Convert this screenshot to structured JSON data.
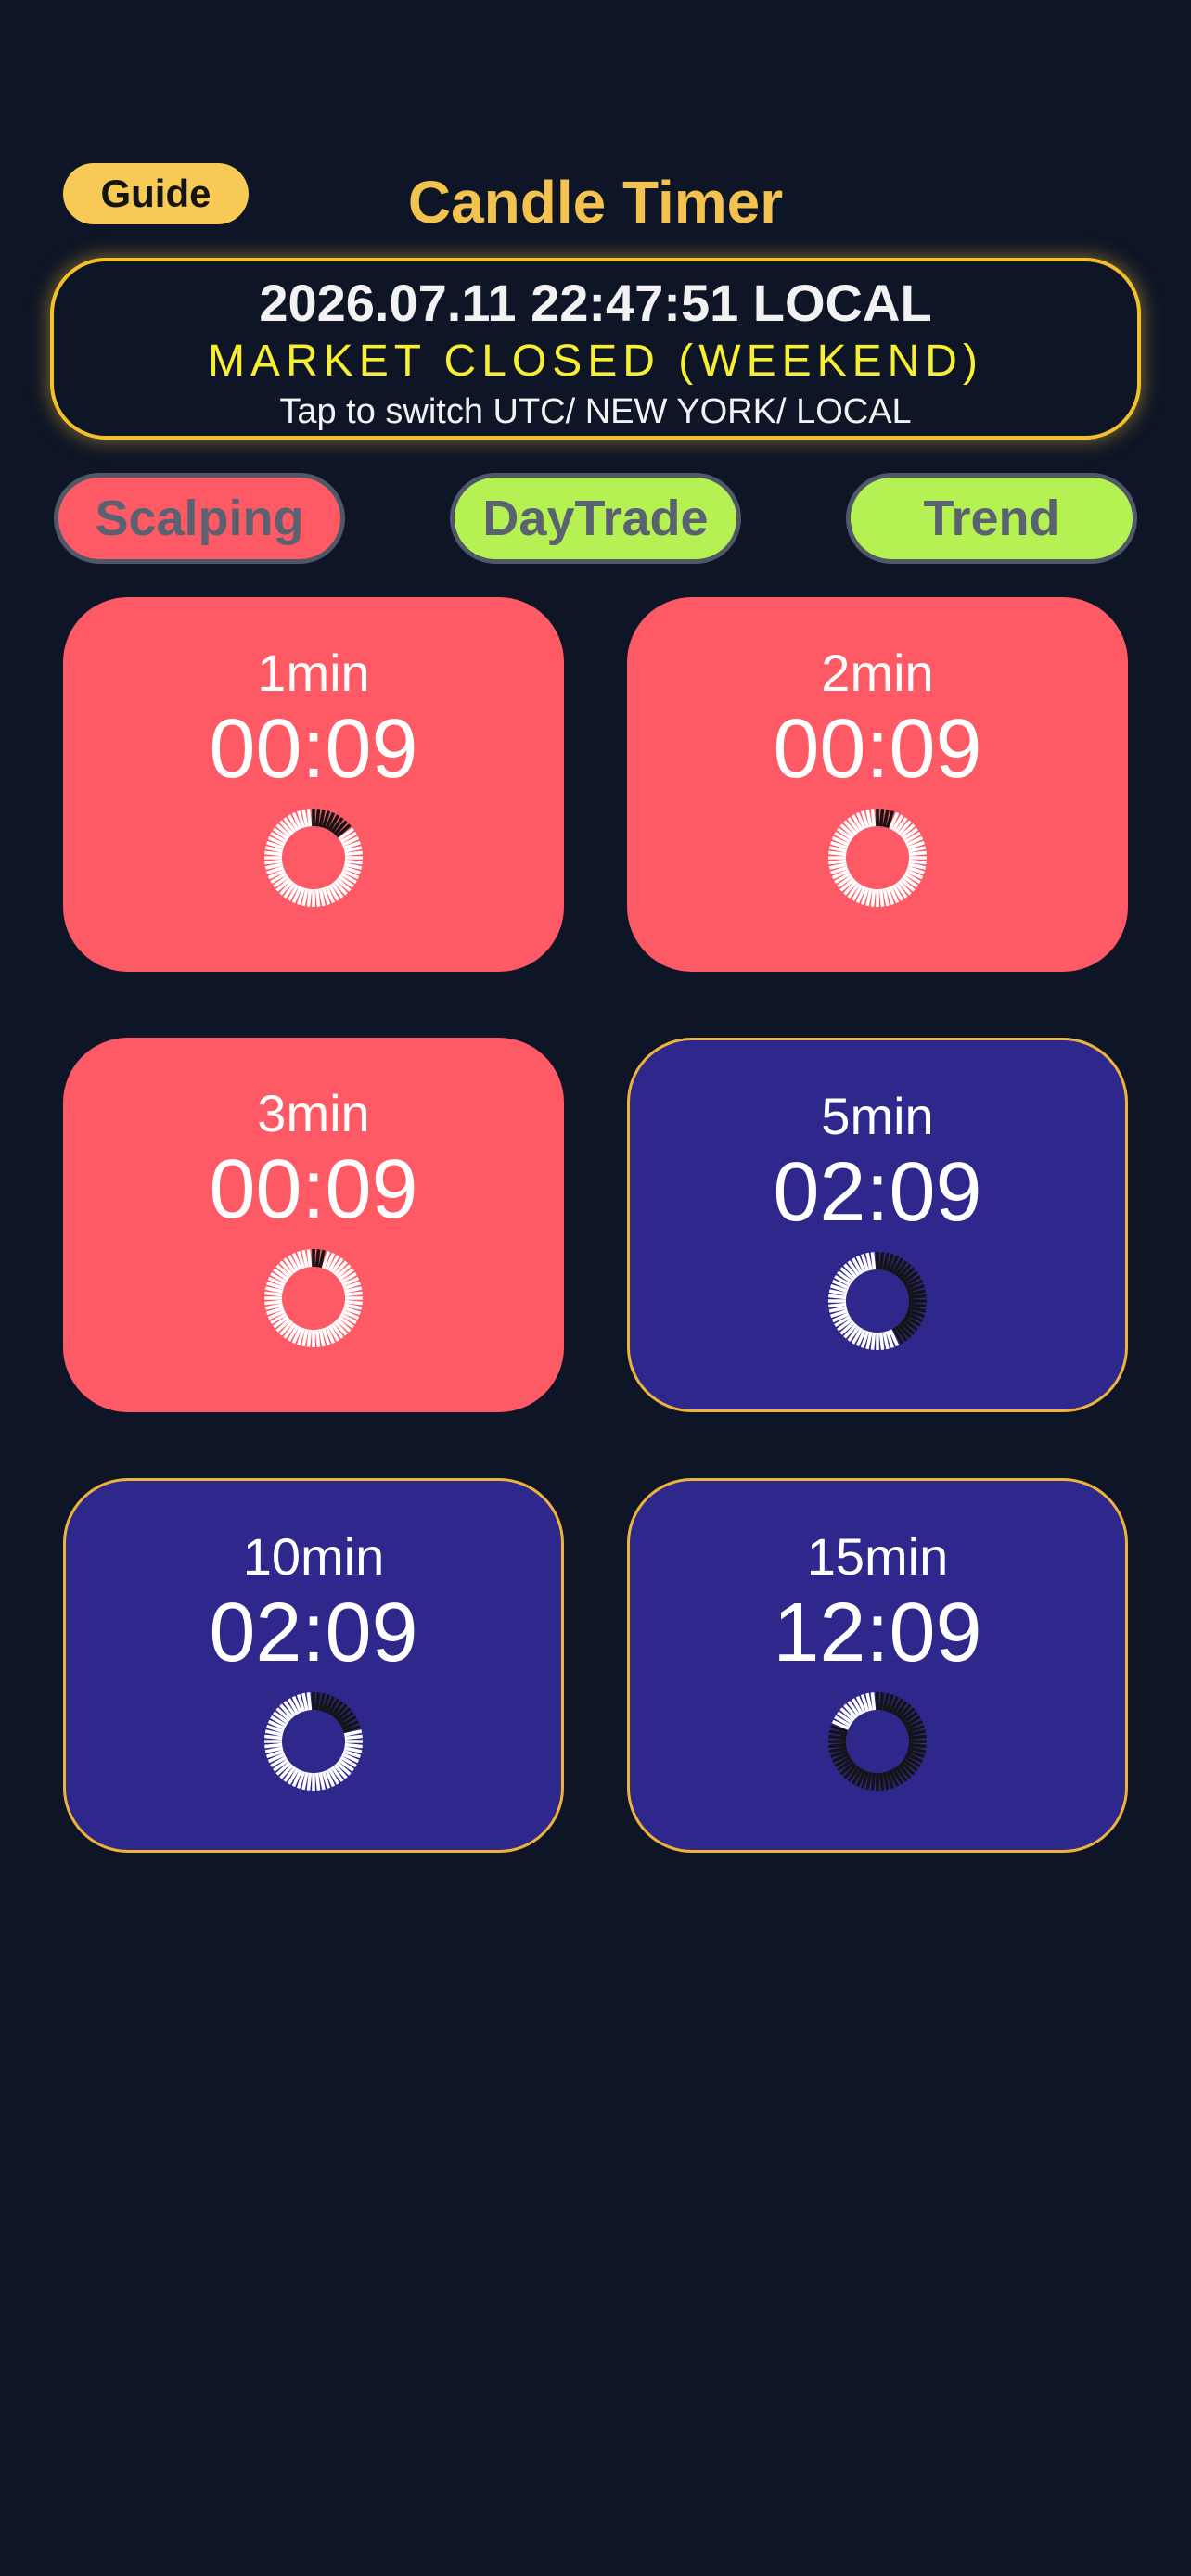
{
  "header": {
    "guide_label": "Guide",
    "title": "Candle Timer"
  },
  "clock": {
    "datetime": "2026.07.11 22:47:51 LOCAL",
    "market_status": "MARKET CLOSED (WEEKEND)",
    "hint": "Tap to switch  UTC/ NEW YORK/ LOCAL"
  },
  "modes": [
    {
      "label": "Scalping"
    },
    {
      "label": "DayTrade"
    },
    {
      "label": "Trend"
    }
  ],
  "timers": [
    {
      "label": "1min",
      "remaining": "00:09",
      "elapsed_fraction": 0.85,
      "style": "alert"
    },
    {
      "label": "2min",
      "remaining": "00:09",
      "elapsed_fraction": 0.925,
      "style": "alert"
    },
    {
      "label": "3min",
      "remaining": "00:09",
      "elapsed_fraction": 0.95,
      "style": "alert"
    },
    {
      "label": "5min",
      "remaining": "02:09",
      "elapsed_fraction": 0.57,
      "style": "normal"
    },
    {
      "label": "10min",
      "remaining": "02:09",
      "elapsed_fraction": 0.785,
      "style": "normal"
    },
    {
      "label": "15min",
      "remaining": "12:09",
      "elapsed_fraction": 0.19,
      "style": "normal"
    }
  ],
  "colors": {
    "background": "#0e1526",
    "accent_gold": "#f4c24f",
    "market_status": "#f7ef2f",
    "alert_card": "#fd5a65",
    "normal_card": "#2e288c",
    "mode_active": "#b6f153",
    "dial_elapsed": "#ffffff",
    "dial_remaining": "#141414"
  }
}
